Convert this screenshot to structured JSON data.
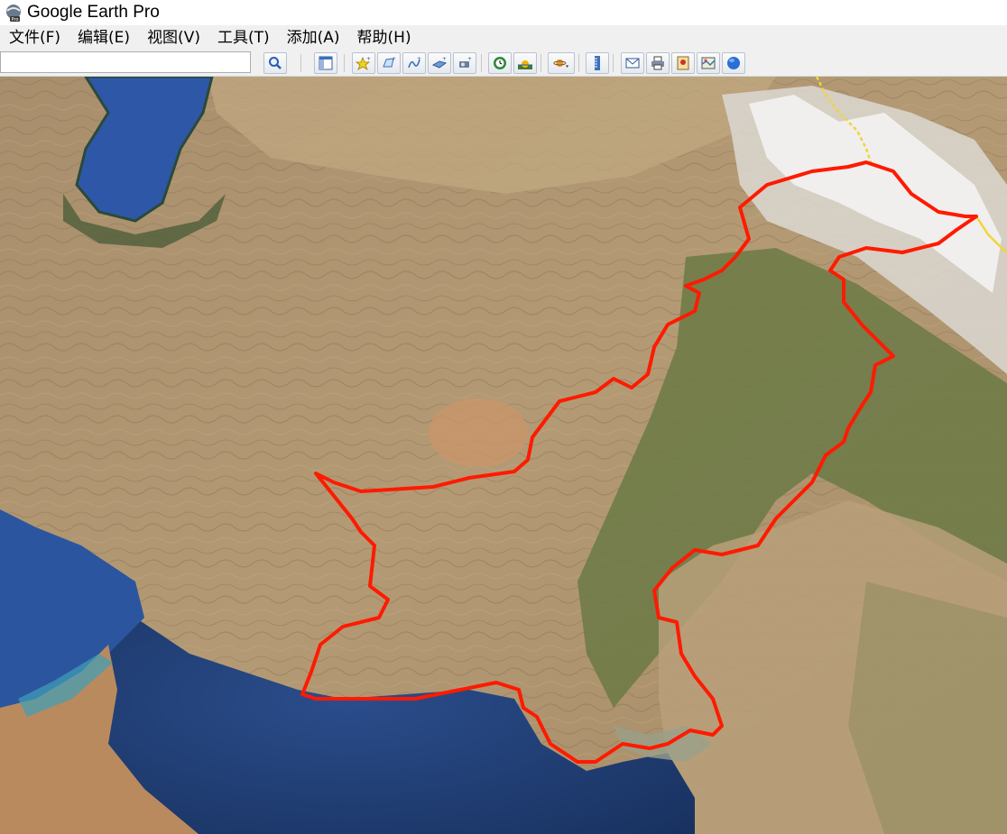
{
  "window": {
    "title": "Google Earth Pro",
    "icon": "google-earth-pro-icon",
    "icon_badge": "Pro"
  },
  "menu": [
    {
      "label": "文件(F)"
    },
    {
      "label": "编辑(E)"
    },
    {
      "label": "视图(V)"
    },
    {
      "label": "工具(T)"
    },
    {
      "label": "添加(A)"
    },
    {
      "label": "帮助(H)"
    }
  ],
  "toolbar": {
    "search_value": "",
    "buttons": [
      "search-icon",
      "sidebar-toggle-icon",
      "add-placemark-icon",
      "add-polygon-icon",
      "add-path-icon",
      "add-image-overlay-icon",
      "record-tour-icon",
      "historical-imagery-icon",
      "sunlight-icon",
      "switch-planet-icon",
      "ruler-icon",
      "email-icon",
      "print-icon",
      "save-image-icon",
      "view-in-google-maps-icon",
      "earth-globe-icon"
    ]
  },
  "map": {
    "region_outline_color": "#ff0000",
    "border_line_color": "#f2d43a",
    "ocean_color": "#1e3f7a",
    "land_color": "#b09672",
    "vegetation_color": "#6b7a45",
    "snow_color": "#f4f4f4"
  }
}
